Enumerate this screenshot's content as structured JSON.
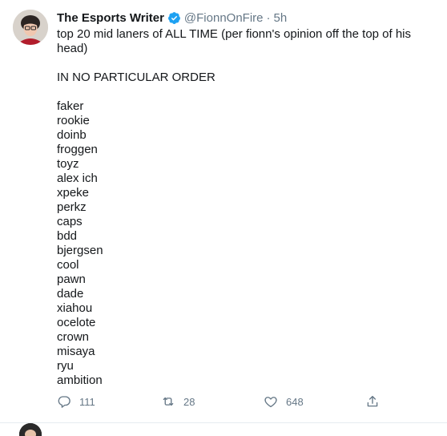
{
  "tweet": {
    "display_name": "The Esports Writer",
    "handle": "@FionnOnFire",
    "separator": "·",
    "time": "5h",
    "text_line1": "top 20 mid laners of ALL TIME (per fionn's opinion off the top of his",
    "text_line2": "head)",
    "subtitle": "IN NO PARTICULAR ORDER",
    "players": [
      "faker",
      "rookie",
      "doinb",
      "froggen",
      "toyz",
      "alex ich",
      "xpeke",
      "perkz",
      "caps",
      "bdd",
      "bjergsen",
      "cool",
      "pawn",
      "dade",
      "xiahou",
      "ocelote",
      "crown",
      "misaya",
      "ryu",
      "ambition"
    ]
  },
  "actions": {
    "reply_count": "111",
    "retweet_count": "28",
    "like_count": "648"
  },
  "colors": {
    "verified": "#1da1f2",
    "secondary_text": "#657786",
    "divider": "#e6ecf0"
  },
  "icons": {
    "verified": "verified-badge-icon",
    "reply": "reply-icon",
    "retweet": "retweet-icon",
    "like": "heart-icon",
    "share": "share-icon"
  }
}
